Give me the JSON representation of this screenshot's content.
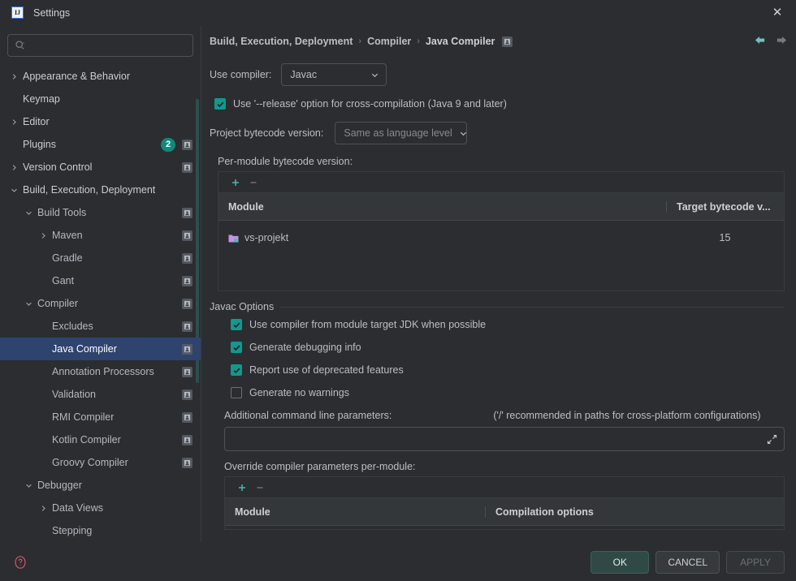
{
  "window": {
    "title": "Settings",
    "logo_text": "IJ",
    "close_label": "✕"
  },
  "search": {
    "value": "",
    "placeholder": ""
  },
  "sidebar": {
    "items": [
      {
        "label": "Appearance & Behavior",
        "level": 0,
        "arrow": "right",
        "bold": true,
        "selected": false,
        "badge": "",
        "scope": false
      },
      {
        "label": "Keymap",
        "level": 0,
        "arrow": "none",
        "bold": true,
        "selected": false,
        "badge": "",
        "scope": false
      },
      {
        "label": "Editor",
        "level": 0,
        "arrow": "right",
        "bold": true,
        "selected": false,
        "badge": "",
        "scope": false
      },
      {
        "label": "Plugins",
        "level": 0,
        "arrow": "none",
        "bold": true,
        "selected": false,
        "badge": "2",
        "scope": true
      },
      {
        "label": "Version Control",
        "level": 0,
        "arrow": "right",
        "bold": true,
        "selected": false,
        "badge": "",
        "scope": true
      },
      {
        "label": "Build, Execution, Deployment",
        "level": 0,
        "arrow": "down",
        "bold": true,
        "selected": false,
        "badge": "",
        "scope": false
      },
      {
        "label": "Build Tools",
        "level": 1,
        "arrow": "down",
        "bold": false,
        "selected": false,
        "badge": "",
        "scope": true
      },
      {
        "label": "Maven",
        "level": 2,
        "arrow": "right",
        "bold": false,
        "selected": false,
        "badge": "",
        "scope": true
      },
      {
        "label": "Gradle",
        "level": 2,
        "arrow": "none",
        "bold": false,
        "selected": false,
        "badge": "",
        "scope": true
      },
      {
        "label": "Gant",
        "level": 2,
        "arrow": "none",
        "bold": false,
        "selected": false,
        "badge": "",
        "scope": true
      },
      {
        "label": "Compiler",
        "level": 1,
        "arrow": "down",
        "bold": false,
        "selected": false,
        "badge": "",
        "scope": true
      },
      {
        "label": "Excludes",
        "level": 2,
        "arrow": "none",
        "bold": false,
        "selected": false,
        "badge": "",
        "scope": true
      },
      {
        "label": "Java Compiler",
        "level": 2,
        "arrow": "none",
        "bold": false,
        "selected": true,
        "badge": "",
        "scope": true
      },
      {
        "label": "Annotation Processors",
        "level": 2,
        "arrow": "none",
        "bold": false,
        "selected": false,
        "badge": "",
        "scope": true
      },
      {
        "label": "Validation",
        "level": 2,
        "arrow": "none",
        "bold": false,
        "selected": false,
        "badge": "",
        "scope": true
      },
      {
        "label": "RMI Compiler",
        "level": 2,
        "arrow": "none",
        "bold": false,
        "selected": false,
        "badge": "",
        "scope": true
      },
      {
        "label": "Kotlin Compiler",
        "level": 2,
        "arrow": "none",
        "bold": false,
        "selected": false,
        "badge": "",
        "scope": true
      },
      {
        "label": "Groovy Compiler",
        "level": 2,
        "arrow": "none",
        "bold": false,
        "selected": false,
        "badge": "",
        "scope": true
      },
      {
        "label": "Debugger",
        "level": 1,
        "arrow": "down",
        "bold": false,
        "selected": false,
        "badge": "",
        "scope": false
      },
      {
        "label": "Data Views",
        "level": 2,
        "arrow": "right",
        "bold": false,
        "selected": false,
        "badge": "",
        "scope": false
      },
      {
        "label": "Stepping",
        "level": 2,
        "arrow": "none",
        "bold": false,
        "selected": false,
        "badge": "",
        "scope": false
      }
    ]
  },
  "breadcrumb": {
    "items": [
      "Build, Execution, Deployment",
      "Compiler",
      "Java Compiler"
    ],
    "separator": "›"
  },
  "main": {
    "use_compiler_label": "Use compiler:",
    "use_compiler_value": "Javac",
    "release_option_label": "Use '--release' option for cross-compilation (Java 9 and later)",
    "release_option_checked": true,
    "project_bytecode_label": "Project bytecode version:",
    "project_bytecode_value": "Same as language level",
    "per_module_label": "Per-module bytecode version:",
    "bytecode_table": {
      "columns": [
        "Module",
        "Target bytecode v..."
      ],
      "rows": [
        {
          "module": "vs-projekt",
          "target": "15"
        }
      ]
    },
    "javac_options_title": "Javac Options",
    "options": [
      {
        "label": "Use compiler from module target JDK when possible",
        "checked": true
      },
      {
        "label": "Generate debugging info",
        "checked": true
      },
      {
        "label": "Report use of deprecated features",
        "checked": true
      },
      {
        "label": "Generate no warnings",
        "checked": false
      }
    ],
    "additional_params_label": "Additional command line parameters:",
    "additional_params_hint": "('/' recommended in paths for cross-platform configurations)",
    "additional_params_value": "",
    "override_label": "Override compiler parameters per-module:",
    "override_table": {
      "columns": [
        "Module",
        "Compilation options"
      ],
      "rows": []
    },
    "add_button_label": "+",
    "remove_button_label": "−"
  },
  "footer": {
    "ok_label": "OK",
    "cancel_label": "CANCEL",
    "apply_label": "APPLY"
  },
  "colors": {
    "accent_teal": "#11998e",
    "selection_blue": "#2e436e",
    "background": "#2b2d30",
    "module_icon_purple": "#c98fe8"
  }
}
